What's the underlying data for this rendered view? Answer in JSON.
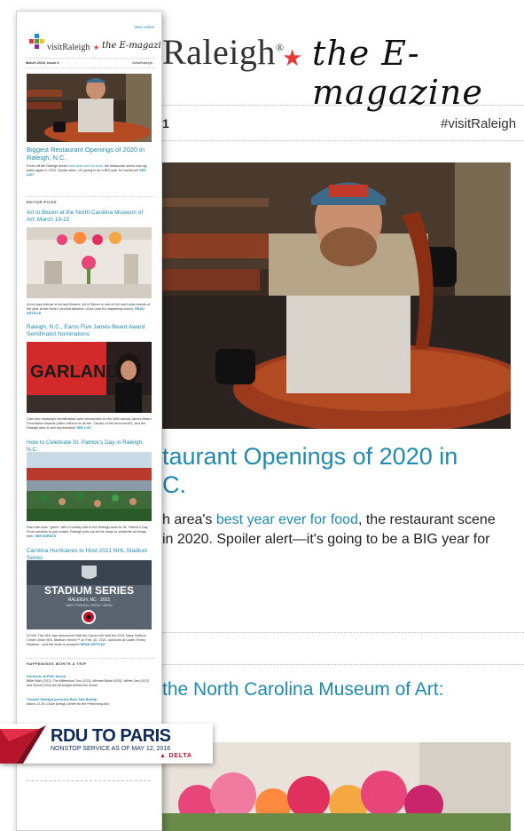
{
  "background": {
    "brand": "Raleigh",
    "registered": "®",
    "tagline": "the E-magazine",
    "issue_fragment": "1",
    "hashtag": "#visitRaleigh",
    "headline_lines": [
      "taurant Openings of 2020 in",
      "C."
    ],
    "body_line1_pre": "h area's ",
    "body_line1_link": "best year ever for food",
    "body_line1_post": ", the restaurant scene",
    "body_line2": "in 2020. Spoiler alert—it's going to be a BIG year for",
    "headline2": "the North Carolina Museum of Art:"
  },
  "newsletter": {
    "view_online": "View online",
    "brand": "visitRaleigh",
    "tagline": "the E-magazine",
    "issue": "March 2020, Issue II",
    "hashtag": "#visitRaleigh",
    "lead": {
      "headline": "Biggest Restaurant Openings of 2020 in Raleigh, N.C.",
      "text_pre": "Fresh off the Raleigh area's ",
      "text_link": "best year ever for food",
      "text_post": ", the restaurant scene has big plans again in 2020. Spoiler alert—it's going to be a BIG year for barbecue! ",
      "cta": "SEE LIST"
    },
    "editor_picks_label": "EDITOR PICKS",
    "articles": [
      {
        "headline": "Art in Bloom at the North Carolina Museum of Art: March 19-22",
        "text": "A four-day festival of art and flowers, Art in Bloom is one of the can't-miss events of the year at the North Carolina Museum of Art (and it's happening soon!). ",
        "cta": "READ ARTICLE"
      },
      {
        "headline": "Raleigh, N.C., Earns Five James Beard Award Semifinalist Nominations",
        "text": "Chef and restaurant semifinalists were announced for the 30th annual James Beard Foundation Awards (often referred to as the \"Oscars of the food world\"), and the Raleigh area is well represented! ",
        "cta": "SEE LIST"
      },
      {
        "headline": "How to Celebrate St. Patrick's Day in Raleigh, N.C.",
        "text": "Paint the town \"green\" with a holiday visit to the Raleigh area for St. Patrick's Day. From parades to pub crawls, Raleigh puts out all the stops to celebrate all things Irish. ",
        "cta": "SEE EVENTS"
      },
      {
        "headline": "Carolina Hurricanes to Host 2021 NHL Stadium Series",
        "text": "ICYMI: The NHL has announced that the Canes will host the 2021 Navy Federal Credit Union NHL Stadium Series™ on Feb. 20, 2021, outdoors at Carter-Finley Stadium—and the team is pumped! ",
        "cta": "READ ARTICLE"
      }
    ],
    "stadium": {
      "line1": "STADIUM SERIES",
      "line2": "RALEIGH, NC · 2021",
      "line3": "NAVY FEDERAL CREDIT UNION"
    },
    "garland_sign": "GARLAND",
    "happenings_label": "HAPPENINGS WORTH A TRIP",
    "events": [
      {
        "title": "Concerts at PNC Arena",
        "text": "Billie Eilish (3/12), The Millennium Tour (3/13), Michael Bublé (3/20), Winter Jam (3/22) and Sound (3/24) are all straight ahead this month"
      },
      {
        "title": "Theatre Raleigh presents Bud, Not Buddy",
        "text": "March 13-29 • Duke Energy Center for the Performing Arts"
      }
    ]
  },
  "ad": {
    "title": "RDU TO PARIS",
    "subtitle": "NONSTOP SERVICE AS OF MAY 12, 2016",
    "airline": "DELTA"
  }
}
